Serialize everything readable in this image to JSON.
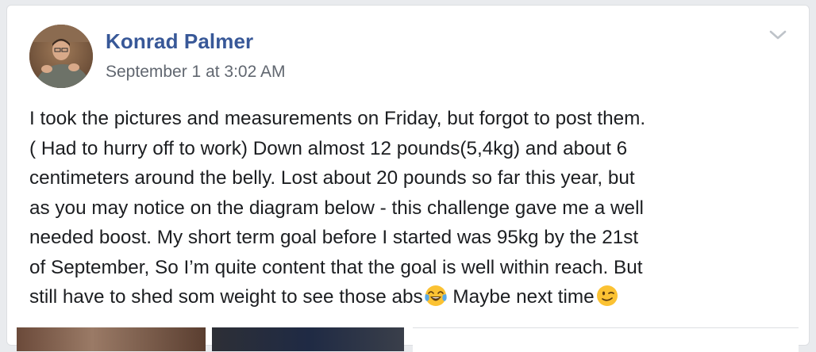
{
  "post": {
    "author": "Konrad Palmer",
    "timestamp": "September 1 at 3:02 AM",
    "body_lines": [
      "I took the pictures and measurements on Friday, but forgot to post them.",
      "( Had to hurry off to work) Down almost 12 pounds(5,4kg) and about 6",
      "centimeters around the belly. Lost about 20 pounds so far this year, but",
      "as you may notice on the diagram below - this challenge gave me a well",
      "needed boost. My short term goal before I started was 95kg by the 21st",
      "of September, So I’m quite content that the goal is well within reach. But",
      "still have to shed som weight to see those abs",
      " Maybe next time"
    ],
    "emojis": [
      "face-with-tears-of-joy-icon",
      "winking-face-icon"
    ]
  },
  "colors": {
    "author_link": "#385898",
    "meta_text": "#616770",
    "body_text": "#1c1e21",
    "card_border": "#dddfe2",
    "page_background": "#e9ebee"
  },
  "icons": {
    "menu": "chevron-down-icon"
  }
}
